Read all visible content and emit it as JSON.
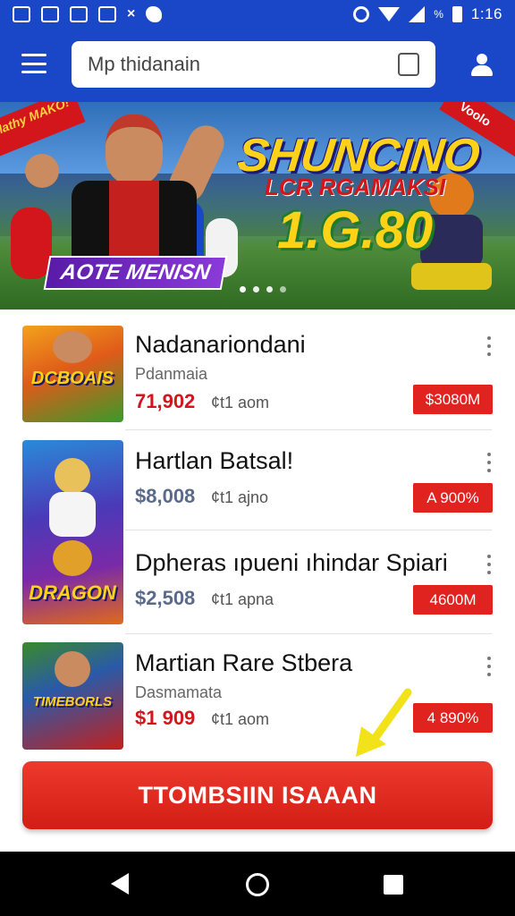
{
  "status_bar": {
    "time": "1:16",
    "battery_label": "%",
    "icons": [
      "gallery-icon",
      "image-icon",
      "app-icon",
      "edit-icon",
      "close-icon",
      "blob-icon",
      "alarm-icon",
      "wifi-icon",
      "signal-icon",
      "battery-icon"
    ]
  },
  "app_bar": {
    "search_text": "Mp thidanain",
    "icons": [
      "menu-icon",
      "square-icon",
      "user-icon"
    ]
  },
  "banner": {
    "ribbon_left": "Mathy MAKO!",
    "ribbon_right": "Voolo",
    "title": "SHUNCINO",
    "subtitle": "LCR RGAMAKSI",
    "big_text": "1.G.80",
    "label": "AOTE MENISN",
    "page_dots": 4,
    "active_dot": 1
  },
  "items": [
    {
      "title": "Nadanariondani",
      "subtitle": "Pdanmaia",
      "price": "71,902",
      "price_color": "#d3161b",
      "meta": "¢t1 aom",
      "badge": "$3080M",
      "thumb_text": "DCBOAIS",
      "thumb_colors": [
        "#f2a21b",
        "#3a9a2a"
      ]
    },
    {
      "title": "Hartlan Batsal!",
      "subtitle": "",
      "price": "$8,008",
      "price_color": "#5a6a8a",
      "meta": "¢t1 ajno",
      "badge": "A 900%",
      "thumb_text": "",
      "thumb_colors": [
        "#2a8ad8",
        "#7a2aa8"
      ]
    },
    {
      "title": "Dpheras ıpueni ıhindar Spiari",
      "subtitle": "",
      "price": "$2,508",
      "price_color": "#5a6a8a",
      "meta": "¢t1 apna",
      "badge": "4600M",
      "thumb_text": "DRAGON",
      "thumb_colors": [
        "#e03a8a",
        "#7a2aa8"
      ]
    },
    {
      "title": "Martian Rare Stbera",
      "subtitle": "Dasmamata",
      "price": "$1 909",
      "price_color": "#d3161b",
      "meta": "¢t1 aom",
      "badge": "4 890%",
      "thumb_text": "TIMEBORLS",
      "thumb_colors": [
        "#3a8a2a",
        "#c3201e"
      ]
    }
  ],
  "cta": {
    "label": "TTOMBSIIN ISAAAN"
  },
  "nav_bar": {
    "icons": [
      "back-icon",
      "home-icon",
      "recents-icon"
    ]
  },
  "colors": {
    "primary": "#1a47c7",
    "accent_red": "#e0231f",
    "arrow_yellow": "#f2e21a"
  }
}
